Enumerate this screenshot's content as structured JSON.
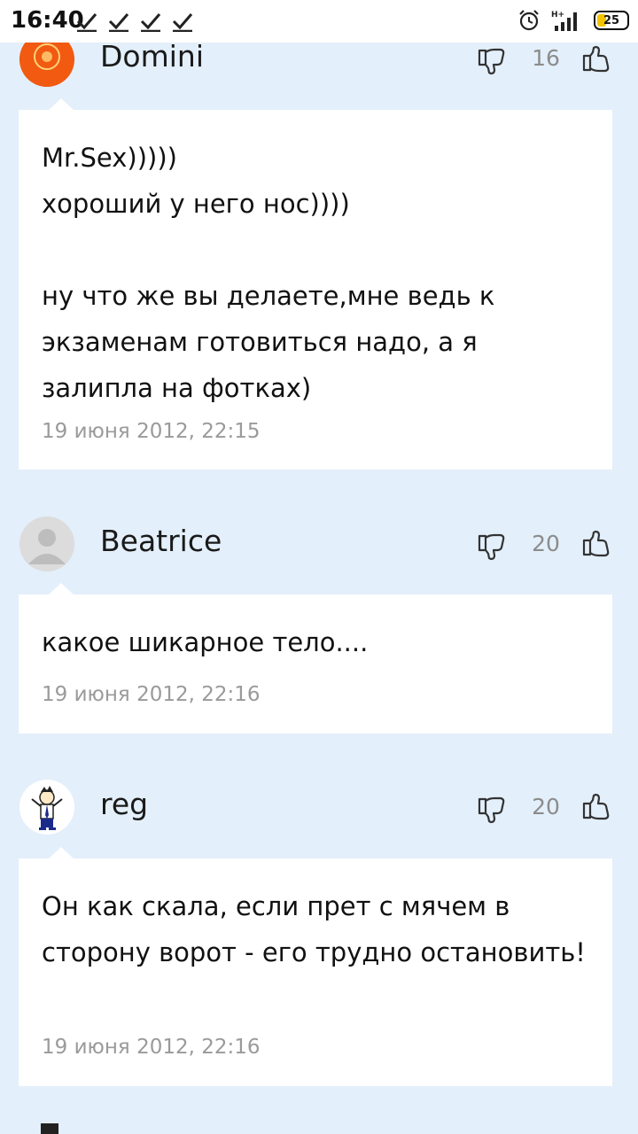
{
  "status_bar": {
    "time": "16:40",
    "battery": "25",
    "icons": [
      "check-icon",
      "check-icon",
      "check-icon",
      "check-icon",
      "alarm-icon",
      "signal-icon",
      "battery-icon"
    ]
  },
  "comments": [
    {
      "author": "Domini",
      "votes": "16",
      "text": "Mr.Sex)))))\nхороший у него нос))))\n\nну что же вы делаете,мне ведь к экзаменам готовиться надо, а я залипла на фотках)",
      "date": "19 июня 2012, 22:15",
      "avatar": "orange-logo-avatar"
    },
    {
      "author": "Beatrice",
      "votes": "20",
      "text": "какое шикарное тело....",
      "date": "19 июня 2012, 22:16",
      "avatar": "default-user-avatar"
    },
    {
      "author": "reg",
      "votes": "20",
      "text": "Он как скала, если прет с мячем в сторону ворот - его трудно остановить!",
      "date": "19 июня 2012, 22:16",
      "avatar": "cartoon-avatar"
    }
  ],
  "colors": {
    "background": "#e3effa",
    "card": "#ffffff",
    "muted_text": "#9a9a9a",
    "avatar_orange": "#f15a10"
  }
}
